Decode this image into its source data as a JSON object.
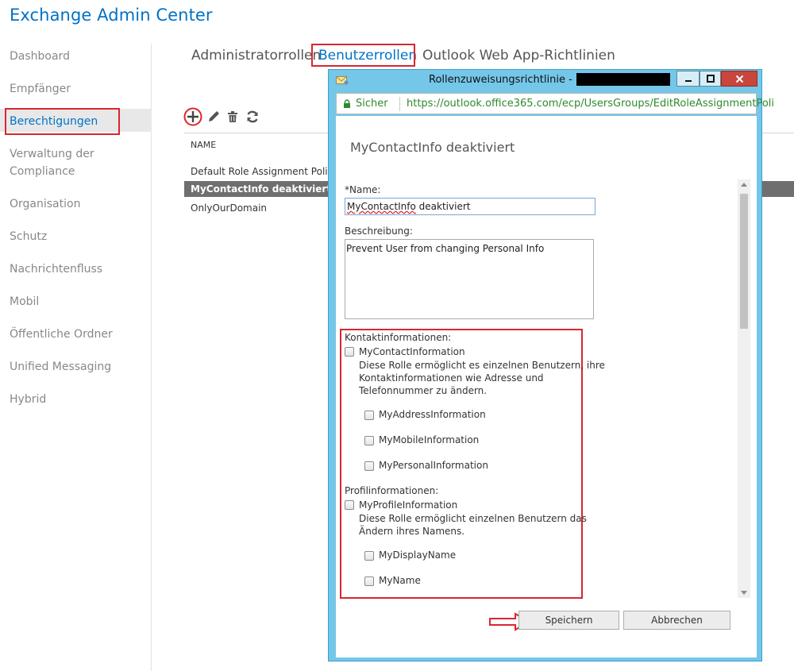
{
  "app": {
    "title": "Exchange Admin Center"
  },
  "sidebar": {
    "items": [
      {
        "label": "Dashboard"
      },
      {
        "label": "Empfänger"
      },
      {
        "label": "Berechtigungen"
      },
      {
        "label": "Verwaltung der Compliance"
      },
      {
        "label": "Organisation"
      },
      {
        "label": "Schutz"
      },
      {
        "label": "Nachrichtenfluss"
      },
      {
        "label": "Mobil"
      },
      {
        "label": "Öffentliche Ordner"
      },
      {
        "label": "Unified Messaging"
      },
      {
        "label": "Hybrid"
      }
    ],
    "selected": "Berechtigungen"
  },
  "tabs": {
    "items": [
      {
        "label": "Administratorrollen"
      },
      {
        "label": "Benutzerrollen"
      },
      {
        "label": "Outlook Web App-Richtlinien"
      }
    ],
    "active": "Benutzerrollen"
  },
  "toolbar": {
    "icons": [
      "add-icon",
      "edit-icon",
      "delete-icon",
      "refresh-icon"
    ]
  },
  "list": {
    "header": "NAME",
    "rows": [
      {
        "name": "Default Role Assignment Policy"
      },
      {
        "name": "MyContactInfo deaktiviert"
      },
      {
        "name": "OnlyOurDomain"
      }
    ],
    "selected_index": 1
  },
  "dialog": {
    "window_title": "Rollenzuweisungsrichtlinie -",
    "security_label": "Sicher",
    "url": "https://outlook.office365.com/ecp/UsersGroups/EditRoleAssignmentPoli",
    "form_title": "MyContactInfo deaktiviert",
    "name_label": "*Name:",
    "name_value_misspelled": "MyContactInfo",
    "name_value_rest": " deaktiviert",
    "description_label": "Beschreibung:",
    "description_value": "Prevent User from changing Personal Info",
    "contact": {
      "heading": "Kontaktinformationen:",
      "role": "MyContactInformation",
      "desc_lines": [
        "Diese Rolle ermöglicht es einzelnen Benutzern, ihre",
        "Kontaktinformationen wie Adresse und",
        "Telefonnummer zu ändern."
      ],
      "subroles": [
        "MyAddressInformation",
        "MyMobileInformation",
        "MyPersonalInformation"
      ]
    },
    "profile": {
      "heading": "Profilinformationen:",
      "role": "MyProfileInformation",
      "desc_lines": [
        "Diese Rolle ermöglicht einzelnen Benutzern das",
        "Ändern ihres Namens."
      ],
      "subroles": [
        "MyDisplayName",
        "MyName"
      ]
    },
    "save_label": "Speichern",
    "cancel_label": "Abbrechen"
  },
  "colors": {
    "accent": "#0072c6",
    "highlight_red": "#d9262e",
    "dialog_frame": "#74c7e9",
    "selected_row": "#6f6f6f"
  }
}
